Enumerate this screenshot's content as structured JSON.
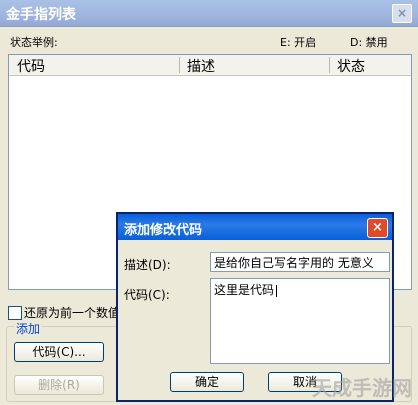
{
  "window": {
    "title": "金手指列表",
    "close_glyph": "×"
  },
  "status": {
    "label": "状态举例:",
    "enabled": "E: 开启",
    "disabled": "D: 禁用"
  },
  "list": {
    "columns": [
      "代码",
      "描述",
      "状态"
    ]
  },
  "restore_checkbox": {
    "label": "还原为前一个数值"
  },
  "group": {
    "title": "添加"
  },
  "buttons": {
    "code": "代码(C)...",
    "delete": "删除(R)"
  },
  "dialog": {
    "title": "添加修改代码",
    "close_glyph": "×",
    "desc_label": "描述(D):",
    "desc_value": "是给你自己写名字用的  无意义",
    "code_label": "代码(C):",
    "code_value": "这里是代码",
    "ok_label": "确定",
    "cancel_label": "取消"
  },
  "watermark": "天成手游网"
}
